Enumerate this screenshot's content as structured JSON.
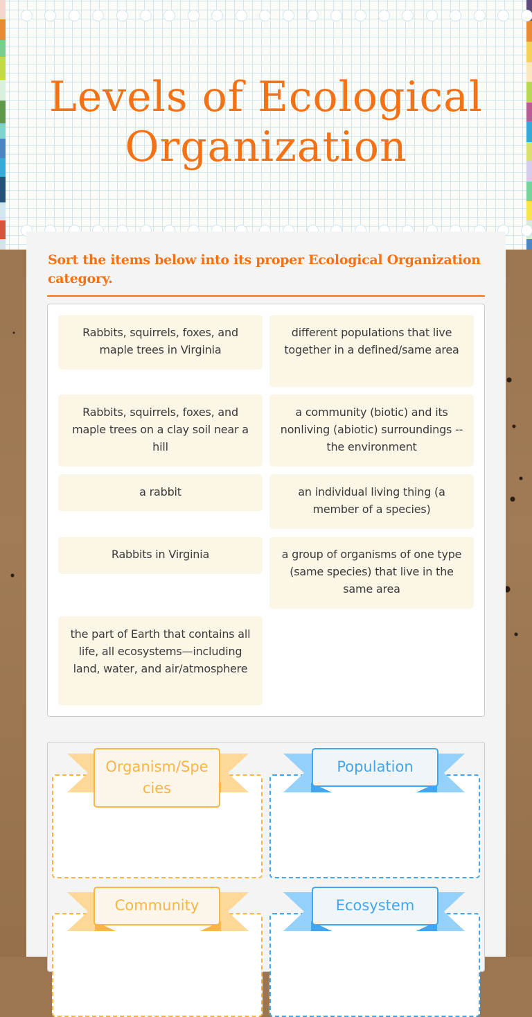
{
  "page": {
    "title": "Levels of Ecological Organization",
    "title_lines": [
      "Levels of Ecological",
      "Organization"
    ]
  },
  "worksheet": {
    "instructions": "Sort the items below into its proper Ecological Organization category.",
    "items": [
      {
        "text": "Rabbits, squirrels, foxes, and maple trees in Virginia",
        "column": "left"
      },
      {
        "text": "different populations that live together in a defined/same area",
        "column": "right"
      },
      {
        "text": "Rabbits, squirrels, foxes, and maple trees on a clay soil near a hill",
        "column": "left"
      },
      {
        "text": "a community (biotic) and its nonliving (abiotic) surroundings -- the environment",
        "column": "right"
      },
      {
        "text": "a rabbit",
        "column": "left"
      },
      {
        "text": "an individual living thing (a member of a species)",
        "column": "right"
      },
      {
        "text": "Rabbits  in Virginia",
        "column": "left"
      },
      {
        "text": "a group of organisms of one type (same species) that live in the same area",
        "column": "right"
      },
      {
        "text": "the part of Earth that contains all life, all ecosystems—including land, water, and air/atmosphere",
        "column": "left"
      }
    ],
    "categories": [
      {
        "label": "Organism/Species",
        "color": "#f8b445",
        "tail_color": "#fdd896"
      },
      {
        "label": "Population",
        "color": "#42a5f0",
        "tail_color": "#94d1fb"
      },
      {
        "label": "Community",
        "color": "#f8b445",
        "tail_color": "#fdd896"
      },
      {
        "label": "Ecosystem",
        "color": "#42a5f0",
        "tail_color": "#94d1fb"
      }
    ]
  },
  "theme": {
    "accent": "#f47216",
    "item_bg": "#fcf6e6",
    "orange": "#f8b445",
    "blue": "#42a5f0"
  }
}
